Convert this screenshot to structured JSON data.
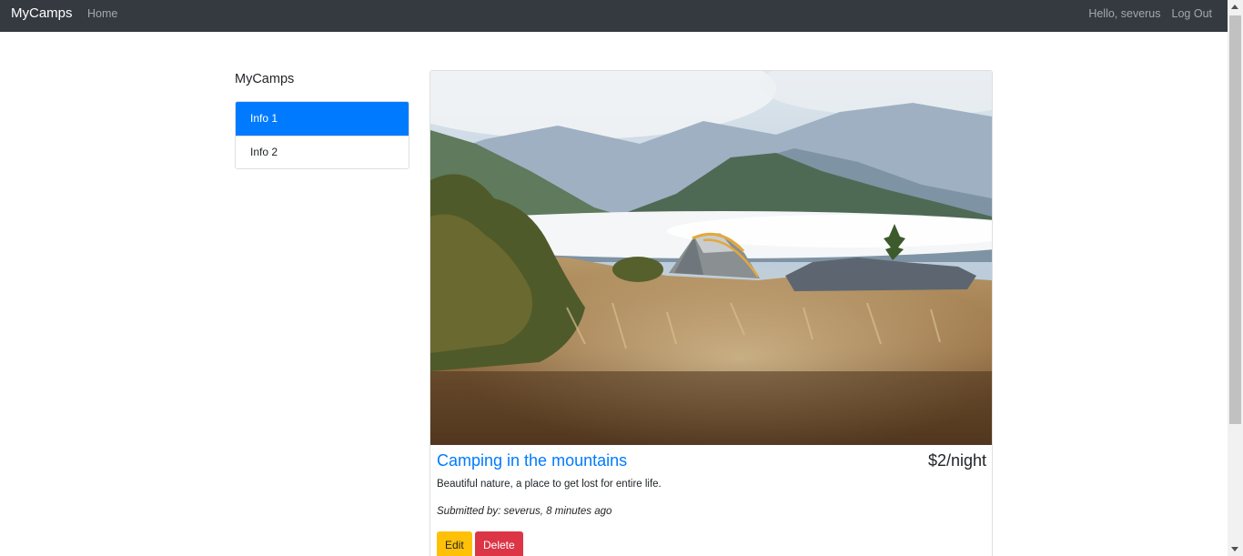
{
  "navbar": {
    "brand": "MyCamps",
    "home": "Home",
    "greeting": "Hello, severus",
    "logout": "Log Out"
  },
  "sidebar": {
    "heading": "MyCamps",
    "items": [
      {
        "label": "Info 1",
        "active": true
      },
      {
        "label": "Info 2",
        "active": false
      }
    ]
  },
  "campground": {
    "title": "Camping in the mountains",
    "price": "$2/night",
    "description": "Beautiful nature, a place to get lost for entire life.",
    "submitted": "Submitted by: severus, 8 minutes ago",
    "edit_label": "Edit",
    "delete_label": "Delete",
    "image": "photo: tent on a hillside with misty mountains"
  },
  "colors": {
    "navbar": "#343a40",
    "primary": "#007bff",
    "warning": "#ffc107",
    "danger": "#dc3545"
  }
}
